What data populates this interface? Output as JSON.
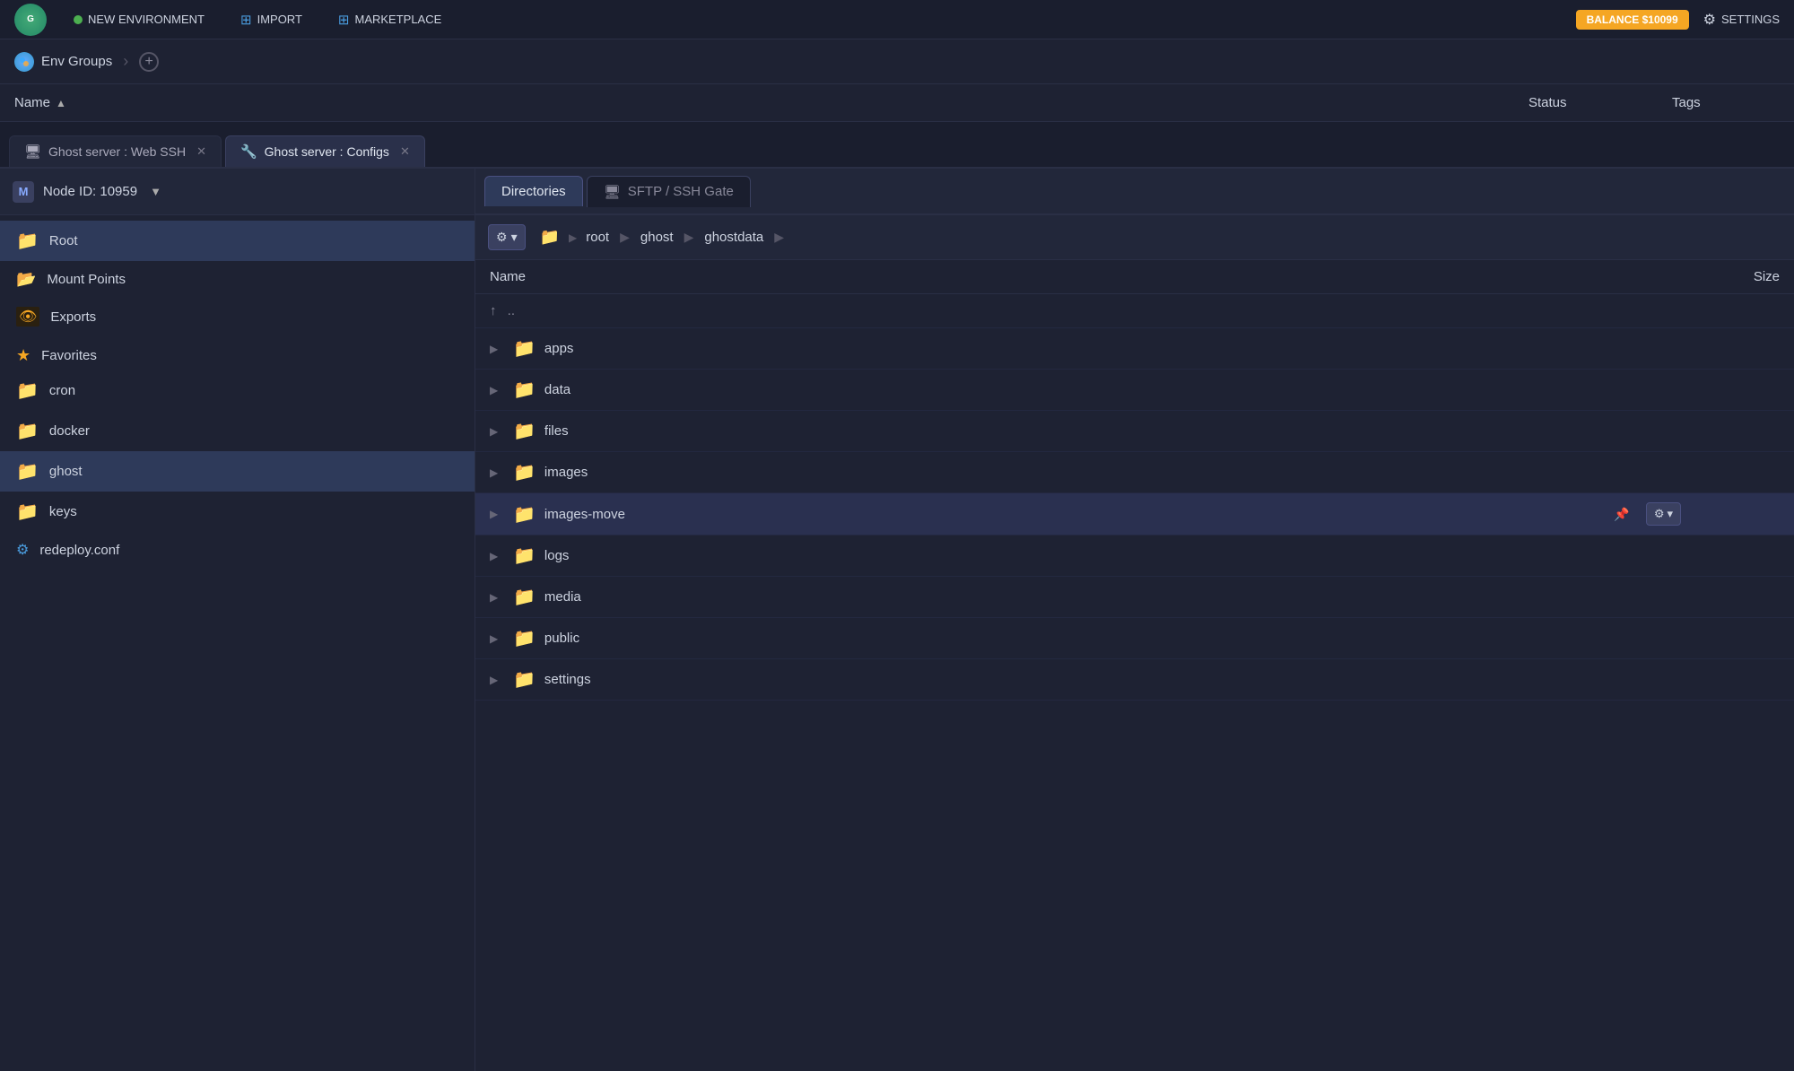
{
  "topbar": {
    "logo": "G",
    "new_env_label": "NEW ENVIRONMENT",
    "import_label": "IMPORT",
    "marketplace_label": "MARKETPLACE",
    "balance_label": "BALANCE $10099",
    "settings_label": "SETTINGS"
  },
  "breadcrumb": {
    "icon": "G",
    "label": "Env Groups",
    "add_tooltip": "Add"
  },
  "column_headers": {
    "name": "Name",
    "status": "Status",
    "tags": "Tags"
  },
  "tabs": [
    {
      "id": "tab-webssh",
      "label": "Ghost server : Web SSH",
      "icon": "🖥",
      "active": false
    },
    {
      "id": "tab-configs",
      "label": "Ghost server : Configs",
      "icon": "🔧",
      "active": true
    }
  ],
  "left_panel": {
    "node_id_label": "Node ID: 10959",
    "items": [
      {
        "id": "root",
        "label": "Root",
        "type": "folder",
        "active": false
      },
      {
        "id": "mount-points",
        "label": "Mount Points",
        "type": "folder-sm",
        "active": false
      },
      {
        "id": "exports",
        "label": "Exports",
        "type": "exports",
        "active": false
      },
      {
        "id": "favorites-header",
        "label": "Favorites",
        "type": "star-header",
        "active": false
      },
      {
        "id": "cron",
        "label": "cron",
        "type": "folder",
        "active": false
      },
      {
        "id": "docker",
        "label": "docker",
        "type": "folder",
        "active": false
      },
      {
        "id": "ghost",
        "label": "ghost",
        "type": "folder",
        "active": true
      },
      {
        "id": "keys",
        "label": "keys",
        "type": "folder",
        "active": false
      },
      {
        "id": "redeploy",
        "label": "redeploy.conf",
        "type": "file",
        "active": false
      }
    ]
  },
  "right_panel": {
    "tabs": [
      {
        "id": "directories",
        "label": "Directories",
        "active": true
      },
      {
        "id": "sftp",
        "label": "SFTP / SSH Gate",
        "icon": "🖥",
        "active": false
      }
    ],
    "path": {
      "parts": [
        "root",
        "ghost",
        "ghostdata"
      ]
    },
    "file_columns": {
      "name": "Name",
      "size": "Size"
    },
    "parent_dir": "..",
    "files": [
      {
        "id": "apps",
        "name": "apps",
        "type": "folder",
        "highlighted": false
      },
      {
        "id": "data",
        "name": "data",
        "type": "folder",
        "highlighted": false
      },
      {
        "id": "files",
        "name": "files",
        "type": "folder",
        "highlighted": false
      },
      {
        "id": "images",
        "name": "images",
        "type": "folder",
        "highlighted": false
      },
      {
        "id": "images-move",
        "name": "images-move",
        "type": "folder-pinned",
        "highlighted": true
      },
      {
        "id": "logs",
        "name": "logs",
        "type": "folder",
        "highlighted": false
      },
      {
        "id": "media",
        "name": "media",
        "type": "folder",
        "highlighted": false
      },
      {
        "id": "public",
        "name": "public",
        "type": "folder",
        "highlighted": false
      },
      {
        "id": "settings",
        "name": "settings",
        "type": "folder",
        "highlighted": false
      }
    ]
  }
}
